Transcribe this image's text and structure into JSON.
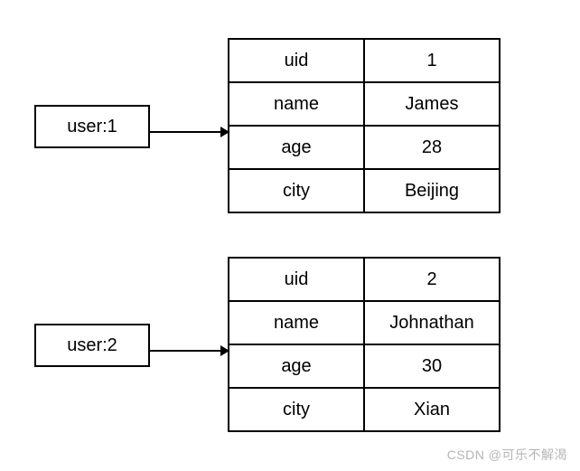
{
  "entries": [
    {
      "key": "user:1",
      "fields": [
        {
          "name": "uid",
          "value": "1"
        },
        {
          "name": "name",
          "value": "James"
        },
        {
          "name": "age",
          "value": "28"
        },
        {
          "name": "city",
          "value": "Beijing"
        }
      ]
    },
    {
      "key": "user:2",
      "fields": [
        {
          "name": "uid",
          "value": "2"
        },
        {
          "name": "name",
          "value": "Johnathan"
        },
        {
          "name": "age",
          "value": "30"
        },
        {
          "name": "city",
          "value": "Xian"
        }
      ]
    }
  ],
  "watermark": "CSDN @可乐不解渴"
}
